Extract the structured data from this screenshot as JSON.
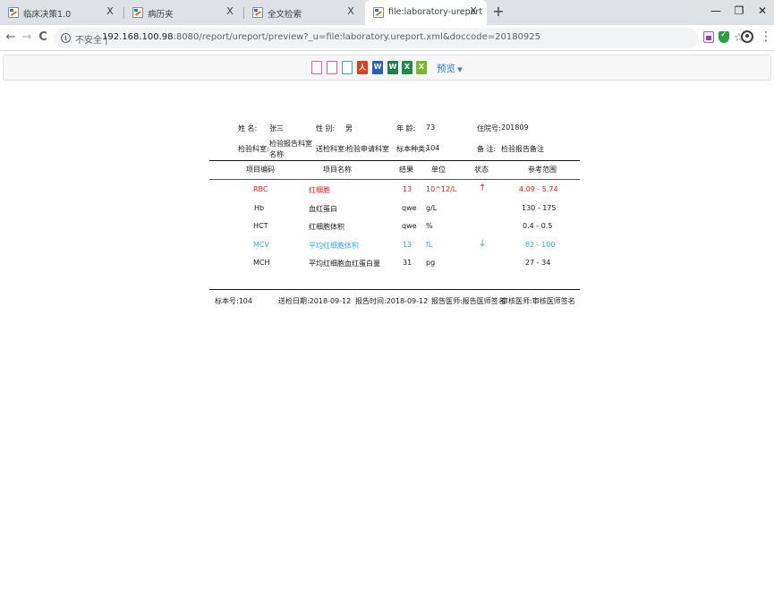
{
  "browser": {
    "tabs": [
      {
        "title": "临床决策1.0",
        "close": "X"
      },
      {
        "title": "病历夹",
        "close": "X"
      },
      {
        "title": "全文检索",
        "close": "X"
      },
      {
        "title": "file:laboratory-ureport",
        "close": "X",
        "active": true
      }
    ],
    "new_tab": "+",
    "window_controls": {
      "minimize": "—",
      "restore": "❐",
      "close": "✕"
    },
    "nav": {
      "back": "←",
      "forward": "→",
      "reload": "C"
    },
    "address": {
      "security_label": "不安全 |",
      "host": "192.168.100.98",
      "rest": ":8080/report/ureport/preview?_u=file:laboratory.ureport.xml&doccode=20180925"
    },
    "menu": "⋮"
  },
  "report_toolbar": {
    "preview_label": "预览",
    "buttons": [
      "print-preview",
      "print",
      "print-direct",
      "pdf",
      "word",
      "word",
      "excel",
      "excel",
      "excel"
    ]
  },
  "report": {
    "header": {
      "name_label": "姓    名:",
      "name_value": "张三",
      "sex_label": "性    别:",
      "sex_value": "男",
      "age_label": "年    龄:",
      "age_value": "73",
      "admission_label": "住院号:",
      "admission_value": "201809",
      "dept_label": "检验科室:",
      "dept_value_line1": "检验报告科室",
      "dept_value_line2": "名称",
      "send_dept_label": "送检科室:",
      "send_dept_value": "检验申请科室",
      "sample_type_label": "标本种类:",
      "sample_type_value": "104",
      "remark_label": "备    注:",
      "remark_value": "检验报告备注"
    },
    "columns": [
      "项目编码",
      "项目名称",
      "结果",
      "单位",
      "状态",
      "参考范围"
    ],
    "rows": [
      {
        "code": "RBC",
        "name": "红细胞",
        "result": "13",
        "unit": "10^12/L",
        "status": "↑",
        "range": "4.09 - 5.74",
        "color": "#e0211b"
      },
      {
        "code": "Hb",
        "name": "血红蛋白",
        "result": "qwe",
        "unit": "g/L",
        "status": "",
        "range": "130 - 175",
        "color": "#1a1a1a"
      },
      {
        "code": "HCT",
        "name": "红细胞体积",
        "result": "qwe",
        "unit": "%",
        "status": "",
        "range": "0.4 - 0.5",
        "color": "#1a1a1a"
      },
      {
        "code": "MCV",
        "name": "平均红细胞体积",
        "result": "13",
        "unit": "fL",
        "status": "↓",
        "range": "82 - 100",
        "color": "#34a8e0"
      },
      {
        "code": "MCH",
        "name": "平均红细胞血红蛋白量",
        "result": "31",
        "unit": "pg",
        "status": "",
        "range": "27 - 34",
        "color": "#1a1a1a"
      }
    ],
    "footer": {
      "sample_no": "标本号:104",
      "send_date": "送检日期:2018-09-12",
      "report_time": "报告时间:2018-09-12",
      "report_doctor": "报告医师:报告医师签名",
      "review_doctor": "审核医师:审核医师签名"
    }
  }
}
